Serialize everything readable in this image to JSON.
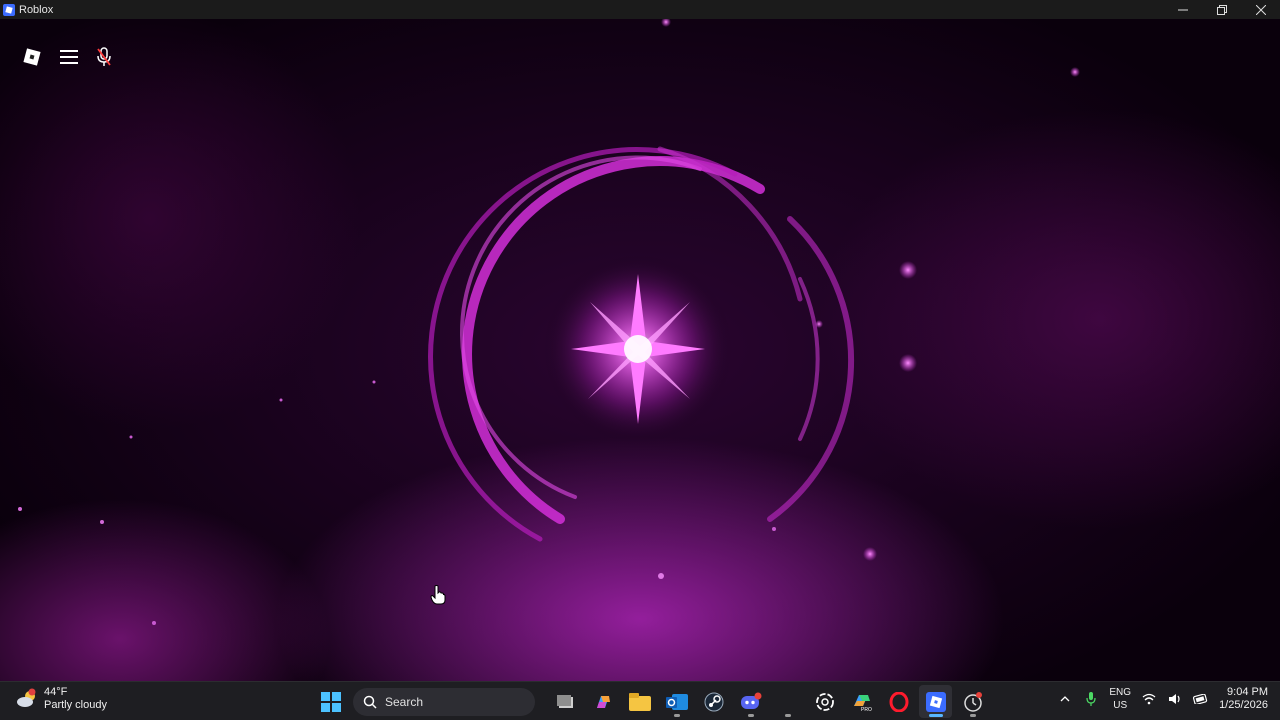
{
  "window": {
    "title": "Roblox",
    "controls": [
      "minimize-icon",
      "restore-icon",
      "close-icon"
    ]
  },
  "game": {
    "topbar": {
      "icons": [
        "roblox-logo-icon",
        "menu-icon",
        "microphone-muted-icon"
      ]
    },
    "scene": "purple-vortex-loading",
    "accent_color": "#e040e8"
  },
  "taskbar": {
    "weather": {
      "temperature": "44°F",
      "condition": "Partly cloudy"
    },
    "search": {
      "placeholder": "Search"
    },
    "pinned_icons": [
      "windows-start-icon",
      "search-icon",
      "task-view-icon",
      "copilot-icon",
      "file-explorer-icon",
      "outlook-icon",
      "steam-icon",
      "discord-icon",
      "blank-app-icon",
      "chatgpt-icon",
      "microsoft-365-icon",
      "opera-icon",
      "roblox-icon",
      "clock-app-icon"
    ],
    "tray": {
      "language": "ENG",
      "region": "US",
      "time": "9:04 PM",
      "date": "1/25/2026",
      "icons": [
        "chevron-up-icon",
        "microphone-icon",
        "wifi-icon",
        "volume-icon",
        "battery-icon"
      ]
    }
  }
}
